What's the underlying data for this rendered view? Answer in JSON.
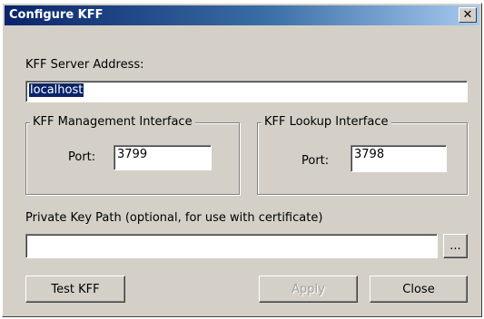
{
  "window": {
    "title": "Configure KFF",
    "close_glyph": "✕"
  },
  "server": {
    "label": "KFF Server Address:",
    "value": "localhost"
  },
  "management": {
    "legend": "KFF Management Interface",
    "port_label": "Port:",
    "port_value": "3799"
  },
  "lookup": {
    "legend": "KFF Lookup Interface",
    "port_label": "Port:",
    "port_value": "3798"
  },
  "private_key": {
    "label": "Private Key Path (optional, for use with certificate)",
    "value": "",
    "browse_label": "..."
  },
  "buttons": {
    "test": "Test KFF",
    "apply": "Apply",
    "close": "Close"
  }
}
